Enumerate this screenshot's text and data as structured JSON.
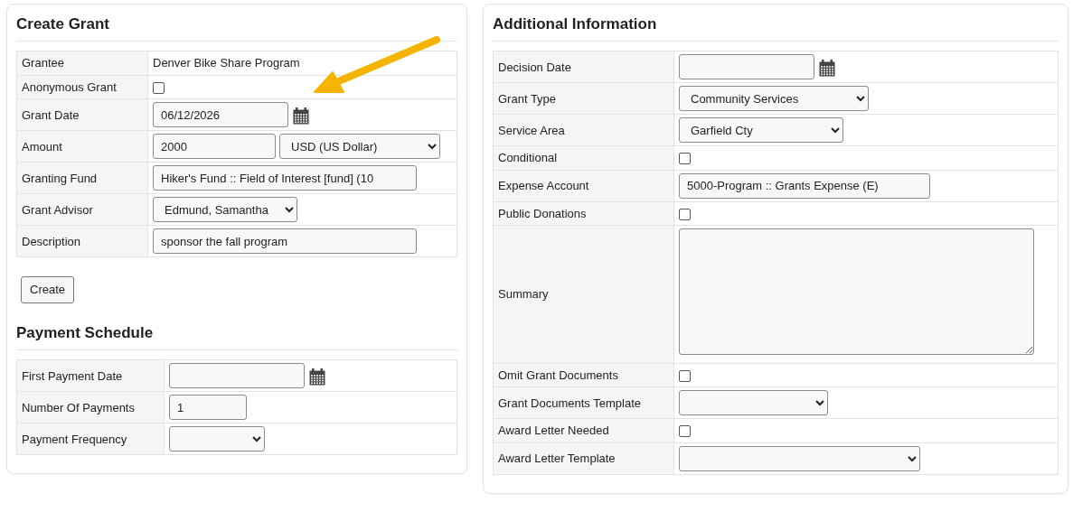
{
  "create_grant": {
    "title": "Create Grant",
    "rows": [
      {
        "label": "Grantee",
        "kind": "text",
        "value": "Denver Bike Share Program"
      },
      {
        "label": "Anonymous Grant",
        "kind": "checkbox",
        "checked": false
      },
      {
        "label": "Grant Date",
        "kind": "date",
        "value": "06/12/2026"
      },
      {
        "label": "Amount",
        "kind": "amount",
        "value": "2000",
        "currency": "USD (US Dollar)"
      },
      {
        "label": "Granting Fund",
        "kind": "input",
        "value": "Hiker's Fund :: Field of Interest [fund] (10"
      },
      {
        "label": "Grant Advisor",
        "kind": "select",
        "value": "Edmund, Samantha"
      },
      {
        "label": "Description",
        "kind": "input",
        "value": "sponsor the fall program"
      }
    ],
    "button": "Create"
  },
  "payment_schedule": {
    "title": "Payment Schedule",
    "rows": [
      {
        "label": "First Payment Date",
        "kind": "date"
      },
      {
        "label": "Number Of Payments",
        "kind": "input",
        "value": "1"
      },
      {
        "label": "Payment Frequency",
        "kind": "select"
      }
    ]
  },
  "additional_information": {
    "title": "Additional Information",
    "rows": [
      {
        "label": "Decision Date",
        "kind": "date"
      },
      {
        "label": "Grant Type",
        "kind": "select",
        "value": "Community Services"
      },
      {
        "label": "Service Area",
        "kind": "select",
        "value": "Garfield Cty"
      },
      {
        "label": "Conditional",
        "kind": "checkbox",
        "checked": false
      },
      {
        "label": "Expense Account",
        "kind": "input",
        "value": "5000-Program :: Grants Expense (E)"
      },
      {
        "label": "Public Donations",
        "kind": "checkbox",
        "checked": false
      },
      {
        "label": "Summary",
        "kind": "textarea"
      },
      {
        "label": "Omit Grant Documents",
        "kind": "checkbox",
        "checked": false
      },
      {
        "label": "Grant Documents Template",
        "kind": "select"
      },
      {
        "label": "Award Letter Needed",
        "kind": "checkbox",
        "checked": false
      },
      {
        "label": "Award Letter Template",
        "kind": "select"
      }
    ]
  }
}
